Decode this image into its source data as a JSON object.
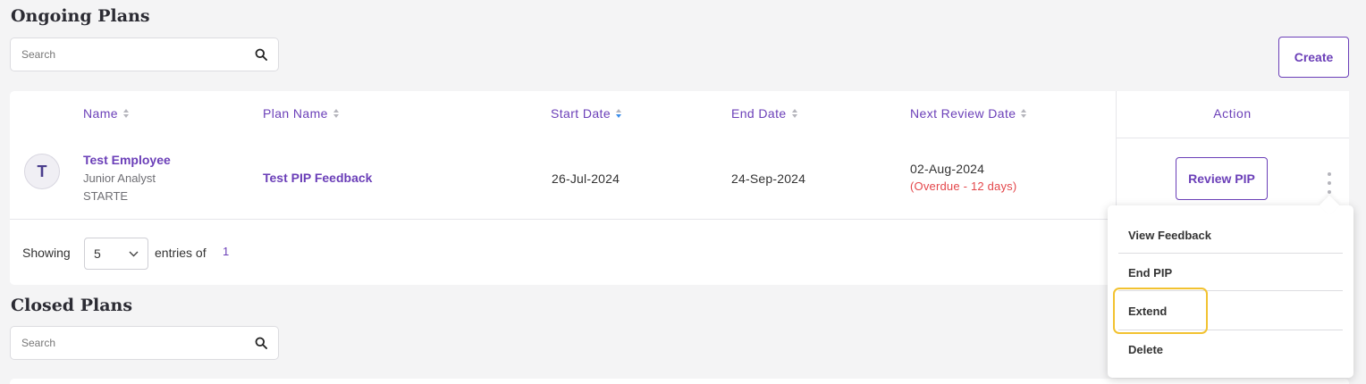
{
  "ongoing": {
    "title": "Ongoing Plans",
    "search_placeholder": "Search",
    "create_label": "Create",
    "columns": {
      "name": "Name",
      "plan_name": "Plan Name",
      "start_date": "Start Date",
      "end_date": "End Date",
      "next_review": "Next Review Date",
      "action": "Action"
    },
    "row": {
      "avatar_initial": "T",
      "employee_name": "Test Employee",
      "designation": "Junior Analyst",
      "department": "STARTE",
      "plan_name": "Test PIP Feedback",
      "start_date": "26-Jul-2024",
      "end_date": "24-Sep-2024",
      "next_review_date": "02-Aug-2024",
      "overdue_text": "(Overdue - 12 days)",
      "review_button": "Review PIP"
    },
    "footer": {
      "showing_label": "Showing",
      "page_size": "5",
      "entries_of_label": "entries of",
      "total": "1"
    }
  },
  "closed": {
    "title": "Closed Plans",
    "search_placeholder": "Search"
  },
  "action_menu": {
    "items": [
      "View Feedback",
      "End PIP",
      "Extend",
      "Delete"
    ],
    "highlighted_item": "Extend"
  },
  "colors": {
    "accent": "#6b3fb8",
    "overdue": "#e4474b",
    "highlight": "#f2c230",
    "sort_active": "#3b8eea"
  }
}
